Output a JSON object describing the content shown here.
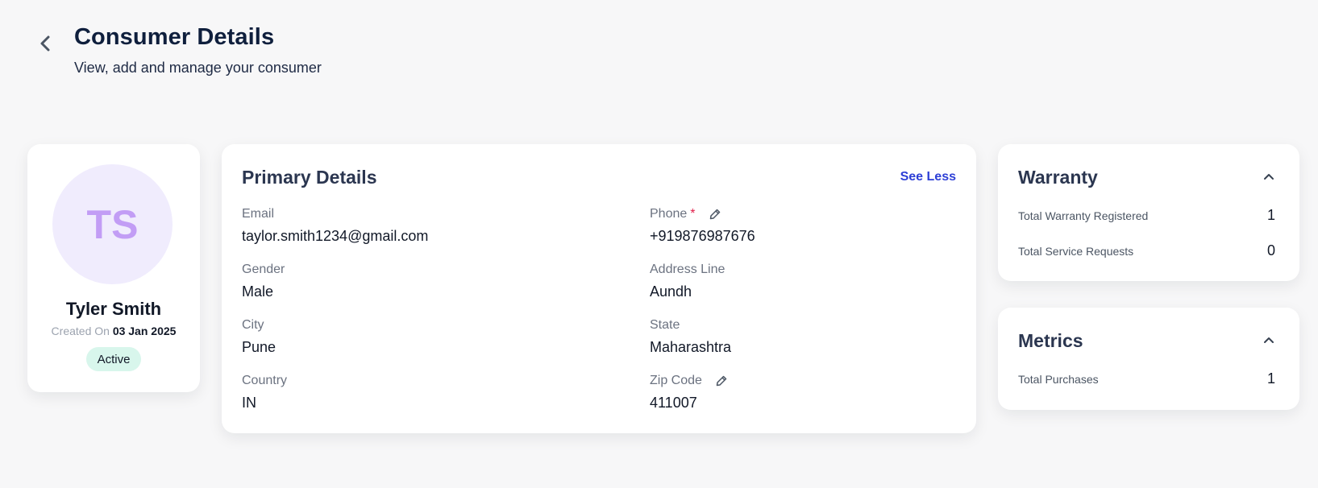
{
  "header": {
    "title": "Consumer Details",
    "subtitle": "View, add and manage your consumer",
    "back_icon": "chevron-left-icon"
  },
  "profile": {
    "initials": "TS",
    "name": "Tyler Smith",
    "created_label": "Created On",
    "created_date": "03 Jan 2025",
    "status": "Active",
    "avatar_bg": "#f0ecfd",
    "avatar_fg": "#c29df5",
    "status_bg": "#d8f6ec"
  },
  "primary": {
    "title": "Primary Details",
    "toggle_label": "See Less",
    "fields": {
      "email": {
        "label": "Email",
        "value": "taylor.smith1234@gmail.com"
      },
      "phone": {
        "label": "Phone",
        "required_mark": "*",
        "value": "+919876987676",
        "edit_icon": "pencil-icon"
      },
      "gender": {
        "label": "Gender",
        "value": "Male"
      },
      "address": {
        "label": "Address Line",
        "value": "Aundh"
      },
      "city": {
        "label": "City",
        "value": "Pune"
      },
      "state": {
        "label": "State",
        "value": "Maharashtra"
      },
      "country": {
        "label": "Country",
        "value": "IN"
      },
      "zip": {
        "label": "Zip Code",
        "value": "411007",
        "edit_icon": "pencil-icon"
      }
    }
  },
  "warranty": {
    "title": "Warranty",
    "collapse_icon": "chevron-up-icon",
    "stats": [
      {
        "label": "Total Warranty Registered",
        "value": "1"
      },
      {
        "label": "Total Service Requests",
        "value": "0"
      }
    ]
  },
  "metrics": {
    "title": "Metrics",
    "collapse_icon": "chevron-up-icon",
    "stats": [
      {
        "label": "Total Purchases",
        "value": "1"
      }
    ]
  },
  "colors": {
    "link": "#2d3fd6",
    "required": "#e11d48",
    "page_bg": "#f7f7f8"
  }
}
